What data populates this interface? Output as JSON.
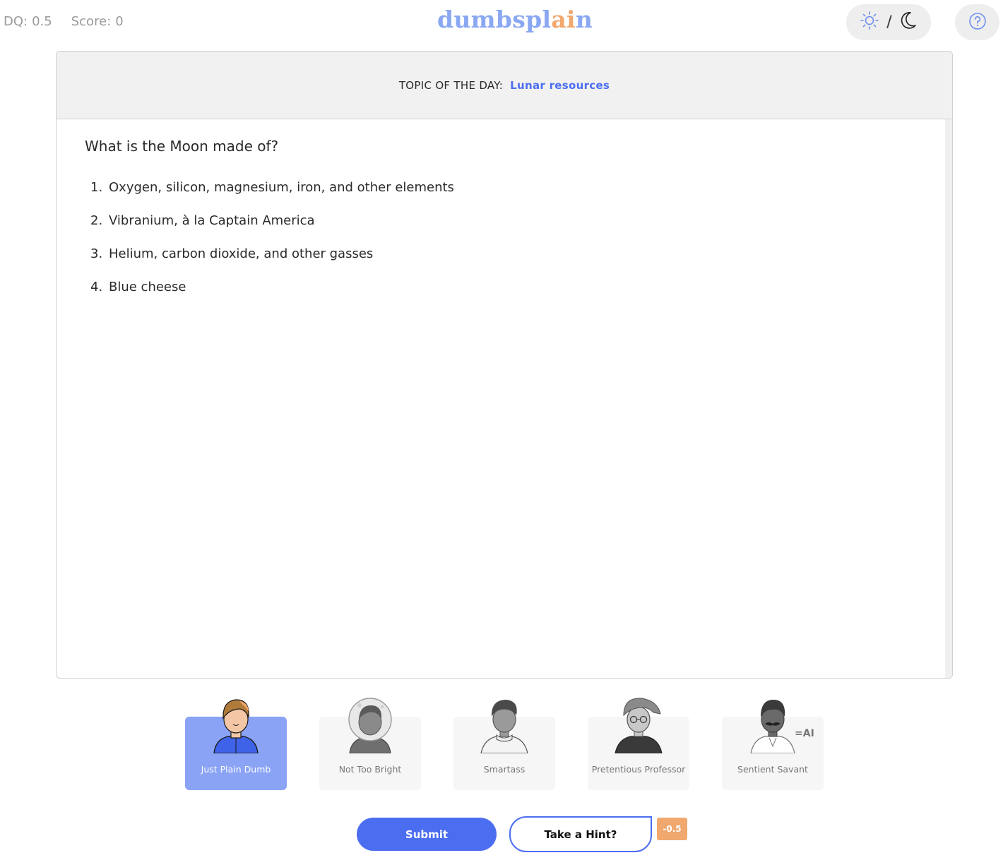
{
  "header": {
    "dq_label": "DQ:",
    "dq_value": "0.5",
    "score_label": "Score:",
    "score_value": "0",
    "logo_main": "dumbspl",
    "logo_accent": "ai",
    "logo_tail": "n",
    "theme_separator": "/",
    "icons": [
      "sun-icon",
      "moon-icon",
      "help-icon"
    ],
    "colors": {
      "logo": "#8aa7f2",
      "logo_accent": "#f0a86f"
    }
  },
  "topic": {
    "label": "TOPIC OF THE DAY:",
    "value": "Lunar resources",
    "color": "#4b6df0"
  },
  "question": {
    "text": "What is the Moon made of?",
    "answers": [
      {
        "num": "1.",
        "text": "Oxygen, silicon, magnesium, iron, and other elements"
      },
      {
        "num": "2.",
        "text": "Vibranium, à la Captain America"
      },
      {
        "num": "3.",
        "text": "Helium, carbon dioxide, and other gasses"
      },
      {
        "num": "4.",
        "text": "Blue cheese"
      }
    ]
  },
  "personas": [
    {
      "label": "Just Plain Dumb",
      "selected": true
    },
    {
      "label": "Not Too Bright",
      "selected": false
    },
    {
      "label": "Smartass",
      "selected": false
    },
    {
      "label": "Pretentious Professor",
      "selected": false
    },
    {
      "label": "Sentient Savant",
      "selected": false,
      "tag": "=AI"
    }
  ],
  "actions": {
    "submit_label": "Submit",
    "hint_label": "Take a Hint?",
    "hint_cost": "-0.5",
    "colors": {
      "primary": "#4b6df0",
      "cost_badge": "#f0a86f",
      "selected_persona": "#8aa3f5"
    }
  }
}
